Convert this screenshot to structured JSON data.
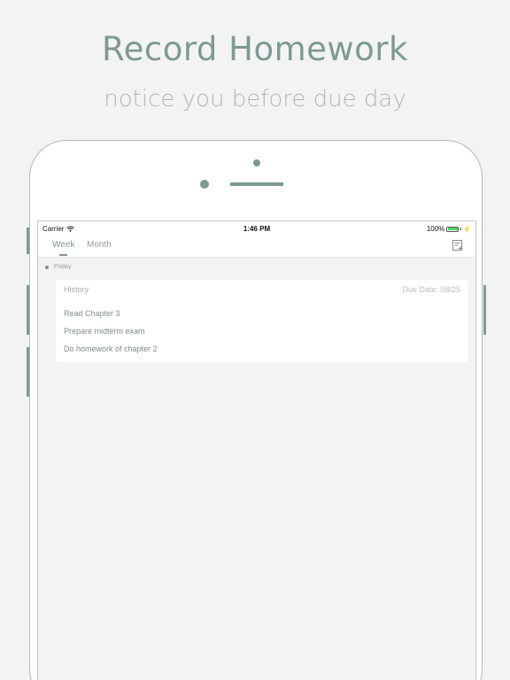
{
  "promo": {
    "title": "Record Homework",
    "subtitle": "notice you before due day"
  },
  "status_bar": {
    "carrier": "Carrier",
    "time": "1:46 PM",
    "battery": "100%"
  },
  "nav": {
    "tabs": [
      {
        "label": "Week",
        "selected": true
      },
      {
        "label": "Month",
        "selected": false
      }
    ],
    "add_icon": "note-add-icon"
  },
  "day": {
    "label": "Friday"
  },
  "card": {
    "subject": "History",
    "due": "Due Date: 08/25",
    "items": [
      "Read Chapter 3",
      "Prepare midterm exam",
      "Do homework of chapter 2"
    ]
  },
  "colors": {
    "accent": "#7d9a90",
    "background": "#f3f3f5",
    "battery": "#4cd964"
  }
}
